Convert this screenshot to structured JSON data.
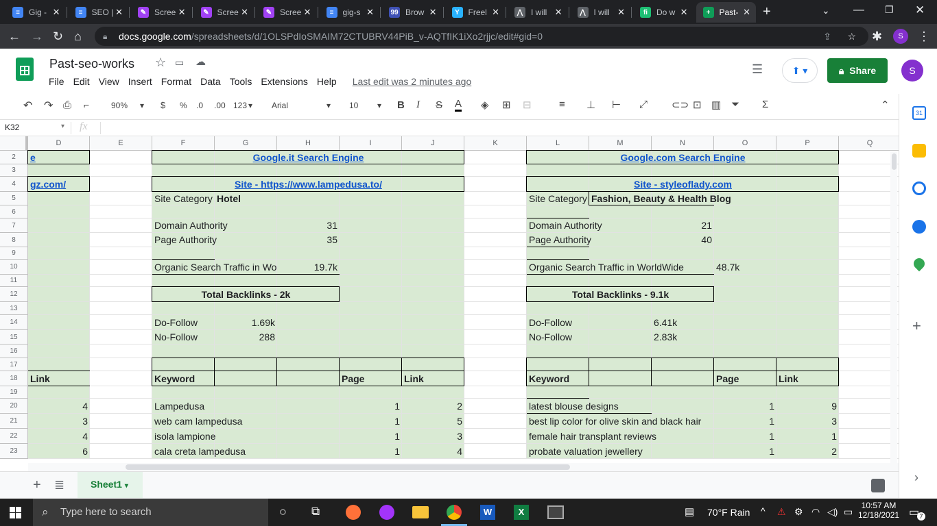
{
  "browser": {
    "tabs": [
      {
        "title": "Gig -",
        "color": "#4285f4",
        "glyph": "≡"
      },
      {
        "title": "SEO |",
        "color": "#4285f4",
        "glyph": "≡"
      },
      {
        "title": "Scree",
        "color": "#a142f4",
        "glyph": "✎"
      },
      {
        "title": "Scree",
        "color": "#a142f4",
        "glyph": "✎"
      },
      {
        "title": "Scree",
        "color": "#a142f4",
        "glyph": "✎"
      },
      {
        "title": "gig-s",
        "color": "#4285f4",
        "glyph": "≡"
      },
      {
        "title": "Brow",
        "color": "#3f51b5",
        "glyph": "99"
      },
      {
        "title": "Freel",
        "color": "#29b2fe",
        "glyph": "Y"
      },
      {
        "title": "I will",
        "color": "#5f6368",
        "glyph": "⋀"
      },
      {
        "title": "I will",
        "color": "#5f6368",
        "glyph": "⋀"
      },
      {
        "title": "Do w",
        "color": "#1dbf73",
        "glyph": "fi"
      },
      {
        "title": "Past-",
        "color": "#0f9d58",
        "glyph": "+"
      }
    ],
    "url_host": "docs.google.com",
    "url_path": "/spreadsheets/d/1OLSPdIoSMAIM72CTUBRV44PiB_v-AQTfIK1iXo2rjjc/edit#gid=0"
  },
  "doc": {
    "title": "Past-seo-works",
    "menu": [
      "File",
      "Edit",
      "View",
      "Insert",
      "Format",
      "Data",
      "Tools",
      "Extensions",
      "Help"
    ],
    "last_edit": "Last edit was 2 minutes ago",
    "share_label": "Share",
    "avatar_letter": "S"
  },
  "toolbar": {
    "zoom": "90%",
    "currency": "$",
    "percent": "%",
    "dec_less": ".0",
    "dec_more": ".00",
    "more_formats": "123",
    "font": "Arial",
    "font_size": "10"
  },
  "formula": {
    "cell_ref": "K32",
    "fx": "fx"
  },
  "grid": {
    "columns": [
      "D",
      "E",
      "F",
      "G",
      "H",
      "I",
      "J",
      "K",
      "L",
      "M",
      "N",
      "O",
      "P",
      "Q"
    ],
    "rows": [
      "2",
      "3",
      "4",
      "5",
      "6",
      "7",
      "8",
      "9",
      "10",
      "11",
      "12",
      "13",
      "14",
      "15",
      "16",
      "17",
      "18",
      "19",
      "20",
      "21",
      "22",
      "23"
    ],
    "colD": {
      "r2": "e",
      "r4": "gz.com/",
      "r18": "Link",
      "values": [
        "4",
        "3",
        "4",
        "6"
      ]
    },
    "left_block": {
      "engine": "Google.it Search Engine",
      "site": "Site - https://www.lampedusa.to/",
      "category_label": "Site Category",
      "category_value": "Hotel",
      "da_label": "Domain Authority",
      "da_value": "31",
      "pa_label": "Page Authority",
      "pa_value": "35",
      "traffic_label": "Organic Search Traffic in Wo",
      "traffic_value": "19.7k",
      "backlinks": "Total Backlinks    - 2k",
      "dofollow_label": "Do-Follow",
      "dofollow_value": "1.69k",
      "nofollow_label": "No-Follow",
      "nofollow_value": "288",
      "hdr_keyword": "Keyword",
      "hdr_page": "Page",
      "hdr_link": "Link",
      "rows": [
        {
          "keyword": "Lampedusa",
          "page": "1",
          "link": "2"
        },
        {
          "keyword": "web cam lampedusa",
          "page": "1",
          "link": "5"
        },
        {
          "keyword": "isola lampione",
          "page": "1",
          "link": "3"
        },
        {
          "keyword": "cala creta lampedusa",
          "page": "1",
          "link": "4"
        }
      ]
    },
    "right_block": {
      "engine": "Google.com Search Engine",
      "site": "Site - styleoflady.com",
      "category_label": "Site Category",
      "category_value": "Fashion, Beauty & Health Blog",
      "da_label": "Domain Authority",
      "da_value": "21",
      "pa_label": "Page Authority",
      "pa_value": "40",
      "traffic_label": "Organic Search Traffic in WorldWide",
      "traffic_value": "48.7k",
      "backlinks": "Total Backlinks    - 9.1k",
      "dofollow_label": "Do-Follow",
      "dofollow_value": "6.41k",
      "nofollow_label": "No-Follow",
      "nofollow_value": "2.83k",
      "hdr_keyword": "Keyword",
      "hdr_page": "Page",
      "hdr_link": "Link",
      "rows": [
        {
          "keyword": "latest blouse designs",
          "page": "1",
          "link": "9"
        },
        {
          "keyword": "best lip color for olive skin and black hair",
          "page": "1",
          "link": "3"
        },
        {
          "keyword": "female hair transplant reviews",
          "page": "1",
          "link": "1"
        },
        {
          "keyword": "probate valuation jewellery",
          "page": "1",
          "link": "2"
        }
      ]
    }
  },
  "sheets": {
    "active": "Sheet1"
  },
  "taskbar": {
    "search_placeholder": "Type here to search",
    "weather": "70°F  Rain",
    "time": "10:57 AM",
    "date": "12/18/2021",
    "notif_count": "7"
  },
  "colors": {
    "fill": "#d9ead3",
    "link": "#1155cc",
    "share": "#188038"
  }
}
